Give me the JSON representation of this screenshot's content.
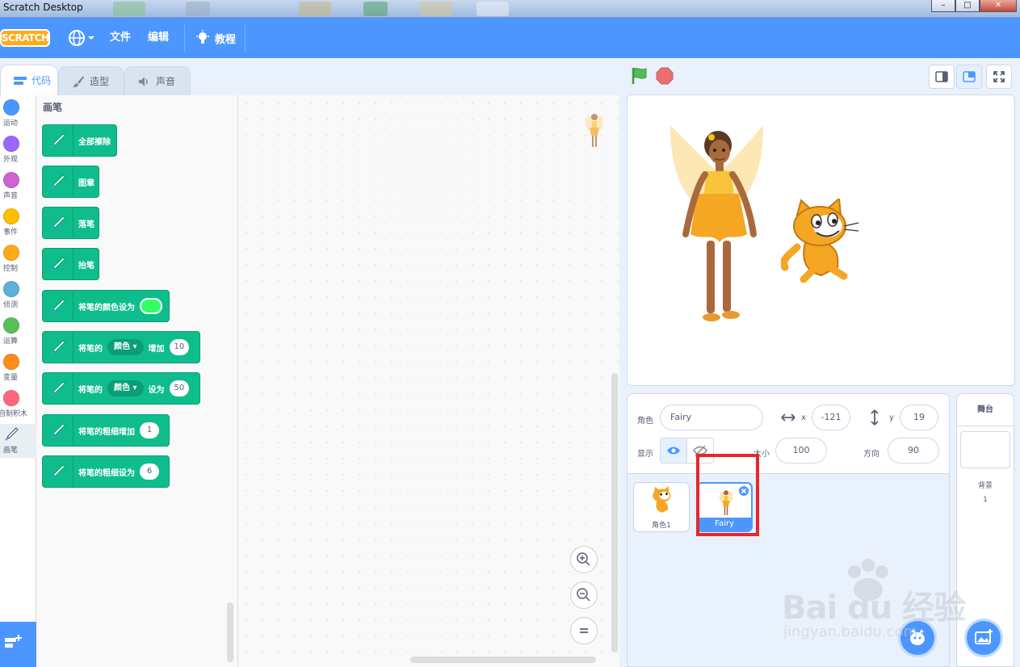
{
  "window": {
    "title": "Scratch Desktop"
  },
  "menubar": {
    "logo": "SCRATCH",
    "file": "文件",
    "edit": "编辑",
    "tutorials": "教程"
  },
  "tabs": {
    "code": "代码",
    "costumes": "造型",
    "sounds": "声音"
  },
  "categories": [
    {
      "label": "运动",
      "color": "#4c97ff"
    },
    {
      "label": "外观",
      "color": "#9966ff"
    },
    {
      "label": "声音",
      "color": "#cf63cf"
    },
    {
      "label": "事件",
      "color": "#ffbf00"
    },
    {
      "label": "控制",
      "color": "#ffab19"
    },
    {
      "label": "侦测",
      "color": "#5cb1d6"
    },
    {
      "label": "运算",
      "color": "#59c059"
    },
    {
      "label": "变量",
      "color": "#ff8c1a"
    },
    {
      "label": "自制积木",
      "color": "#ff6680"
    },
    {
      "label": "画笔",
      "color": "#0fbd8c"
    }
  ],
  "palette": {
    "title": "画笔",
    "blocks": {
      "clear": "全部擦除",
      "stamp": "图章",
      "pen_down": "落笔",
      "pen_up": "抬笔",
      "set_color": "将笔的颜色设为",
      "change_param_prefix": "将笔的",
      "change_param_dropdown": "颜色",
      "change_param_suffix": "增加",
      "change_param_value": "10",
      "set_param_prefix": "将笔的",
      "set_param_dropdown": "颜色",
      "set_param_suffix": "设为",
      "set_param_value": "50",
      "change_size": "将笔的粗细增加",
      "change_size_value": "1",
      "set_size": "将笔的粗细设为",
      "set_size_value": "6"
    }
  },
  "sprite_info": {
    "sprite_label": "角色",
    "sprite_name": "Fairy",
    "x_label": "x",
    "x_value": "-121",
    "y_label": "y",
    "y_value": "19",
    "show_label": "显示",
    "size_label": "大小",
    "size_value": "100",
    "direction_label": "方向",
    "direction_value": "90"
  },
  "sprites": [
    {
      "name": "角色1",
      "selected": false
    },
    {
      "name": "Fairy",
      "selected": true
    }
  ],
  "stage_panel": {
    "title": "舞台",
    "backdrops_label": "背景",
    "backdrops_count": "1"
  },
  "watermark": {
    "brand": "Bai du 经验",
    "url": "jingyan.baidu.com"
  },
  "colors": {
    "menubar": "#4c97ff",
    "pen_block": "#0fbd8c",
    "highlight": "#e8262b",
    "accent": "#4c97ff"
  }
}
